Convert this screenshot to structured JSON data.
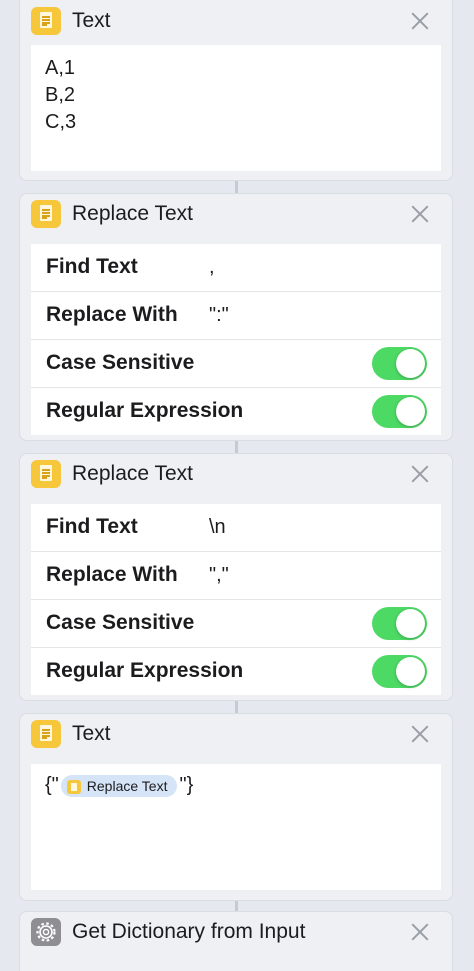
{
  "cards": {
    "text1": {
      "title": "Text",
      "lines": [
        "A,1",
        "B,2",
        "C,3"
      ]
    },
    "replace1": {
      "title": "Replace Text",
      "find_label": "Find Text",
      "find_value": ",",
      "replace_label": "Replace With",
      "replace_value": "\":\"",
      "case_label": "Case Sensitive",
      "case_on": true,
      "regex_label": "Regular Expression",
      "regex_on": true
    },
    "replace2": {
      "title": "Replace Text",
      "find_label": "Find Text",
      "find_value": "\\n",
      "replace_label": "Replace With",
      "replace_value": "\",\"",
      "case_label": "Case Sensitive",
      "case_on": true,
      "regex_label": "Regular Expression",
      "regex_on": true
    },
    "text2": {
      "title": "Text",
      "prefix": "{\"",
      "token_label": "Replace Text",
      "suffix": "\"}"
    },
    "dict": {
      "title": "Get Dictionary from Input"
    }
  },
  "colors": {
    "toggle_on": "#4cd964",
    "text_icon": "#f6c63b",
    "scripting_icon": "#8e8e93",
    "variable_token": "#d6e4f7"
  },
  "icons": {
    "text_action": "document-icon",
    "dictionary_action": "gear-icon",
    "remove": "close-icon"
  }
}
